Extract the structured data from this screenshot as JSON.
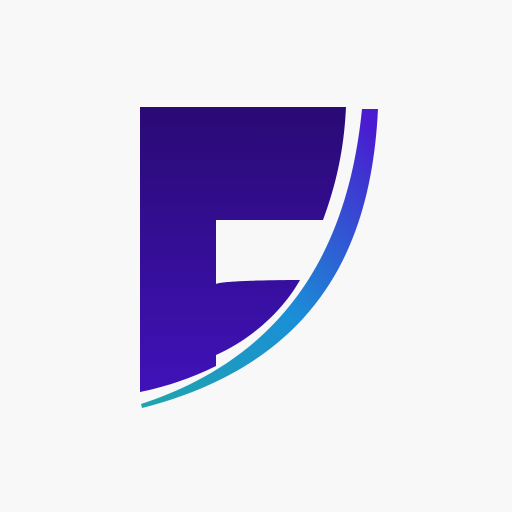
{
  "logo": {
    "icon": "letter-f-swoosh-logo",
    "letter": "F",
    "colors": {
      "background": "#f8f8f9",
      "letter_top": "#2a0a74",
      "letter_bottom": "#3f12b8",
      "swoosh_top": "#4a1bd0",
      "swoosh_mid": "#1a8fd6",
      "swoosh_bottom": "#1fa3b0"
    }
  }
}
